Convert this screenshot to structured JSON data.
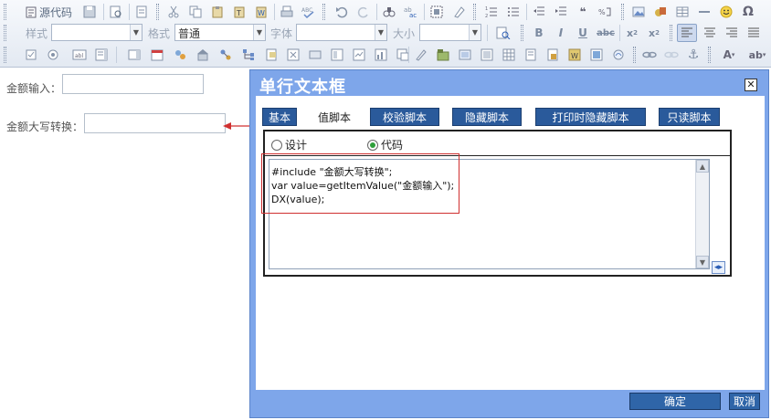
{
  "toolbar": {
    "source_label": "源代码",
    "style_label": "样式",
    "format_label": "格式",
    "format_value": "普通",
    "font_label": "字体",
    "font_value": "",
    "size_label": "大小",
    "size_value": ""
  },
  "form": {
    "amount_label": "金额输入：",
    "amount_value": "",
    "upper_label": "金额大写转换：",
    "upper_value": ""
  },
  "dialog": {
    "title": "单行文本框",
    "close_glyph": "✕",
    "tabs": [
      {
        "label": "基本",
        "active": false
      },
      {
        "label": "值脚本",
        "active": true
      },
      {
        "label": "校验脚本",
        "active": false
      },
      {
        "label": "隐藏脚本",
        "active": false
      },
      {
        "label": "打印时隐藏脚本",
        "active": false
      },
      {
        "label": "只读脚本",
        "active": false
      }
    ],
    "mode": {
      "design_label": "设计",
      "code_label": "代码",
      "selected": "代码"
    },
    "code_lines": [
      "#include \"金额大写转换\";",
      "var value=getItemValue(\"金额输入\");",
      "DX(value);"
    ],
    "ok_label": "确定",
    "cancel_label": "取消"
  },
  "colors": {
    "dialog_bg": "#7ea6ea",
    "tab_bg": "#2a5a9b",
    "annotation": "#d03030",
    "radio_selected": "#2e9f3a"
  }
}
